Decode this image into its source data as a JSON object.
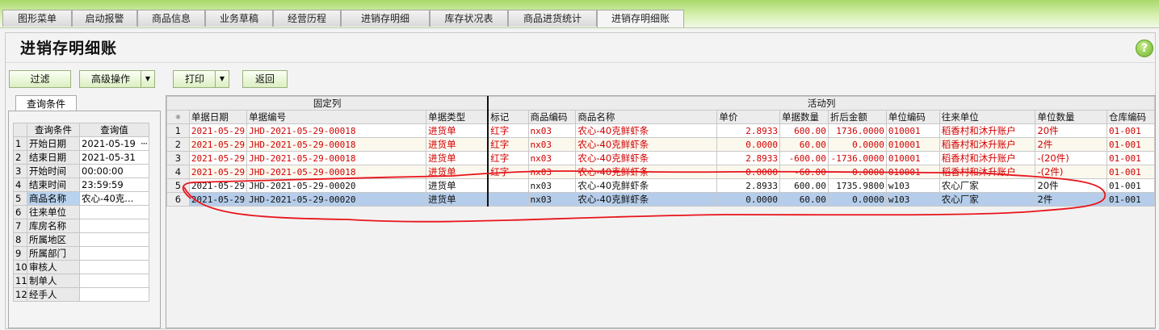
{
  "tabs": [
    {
      "label": "图形菜单",
      "active": false
    },
    {
      "label": "启动报警",
      "active": false
    },
    {
      "label": "商品信息",
      "active": false
    },
    {
      "label": "业务草稿",
      "active": false
    },
    {
      "label": "经营历程",
      "active": false
    },
    {
      "label": "进销存明细",
      "active": false
    },
    {
      "label": "库存状况表",
      "active": false
    },
    {
      "label": "商品进货统计",
      "active": false
    },
    {
      "label": "进销存明细账",
      "active": true
    }
  ],
  "page": {
    "title": "进销存明细账",
    "help_icon": "help-icon",
    "help_glyph": "?"
  },
  "toolbar": {
    "filter": "过滤",
    "advanced": "高级操作",
    "print": "打印",
    "back": "返回"
  },
  "query": {
    "tab_label": "查询条件",
    "col_condition": "查询条件",
    "col_value": "查询值",
    "rows": [
      {
        "n": "1",
        "key": "开始日期",
        "value": "2021-05-19",
        "more": "···"
      },
      {
        "n": "2",
        "key": "结束日期",
        "value": "2021-05-31"
      },
      {
        "n": "3",
        "key": "开始时间",
        "value": "00:00:00"
      },
      {
        "n": "4",
        "key": "结束时间",
        "value": "23:59:59"
      },
      {
        "n": "5",
        "key": "商品名称",
        "value": "农心-40克..."
      },
      {
        "n": "6",
        "key": "往来单位",
        "value": ""
      },
      {
        "n": "7",
        "key": "库房名称",
        "value": ""
      },
      {
        "n": "8",
        "key": "所属地区",
        "value": ""
      },
      {
        "n": "9",
        "key": "所属部门",
        "value": ""
      },
      {
        "n": "10",
        "key": "审核人",
        "value": ""
      },
      {
        "n": "11",
        "key": "制单人",
        "value": ""
      },
      {
        "n": "12",
        "key": "经手人",
        "value": ""
      }
    ]
  },
  "grid": {
    "group_fixed": "固定列",
    "group_active": "活动列",
    "corner": "⁕",
    "columns": [
      "单据日期",
      "单据编号",
      "单据类型",
      "标记",
      "商品编码",
      "商品名称",
      "单价",
      "单据数量",
      "折后金额",
      "单位编码",
      "往来单位",
      "单位数量",
      "仓库编码"
    ],
    "rows": [
      {
        "n": "1",
        "date": "2021-05-29",
        "no": "JHD-2021-05-29-00018",
        "type": "进货单",
        "mark": "红字",
        "code": "nx03",
        "name": "农心-40克鲜虾条",
        "price": "2.8933",
        "qty": "600.00",
        "amount": "1736.0000",
        "unit_code": "010001",
        "partner": "稻香村和沐升账户",
        "unit_qty": "20件",
        "wh": "01-001",
        "style": "red"
      },
      {
        "n": "2",
        "date": "2021-05-29",
        "no": "JHD-2021-05-29-00018",
        "type": "进货单",
        "mark": "红字",
        "code": "nx03",
        "name": "农心-40克鲜虾条",
        "price": "0.0000",
        "qty": "60.00",
        "amount": "0.0000",
        "unit_code": "010001",
        "partner": "稻香村和沐升账户",
        "unit_qty": "2件",
        "wh": "01-001",
        "style": "red"
      },
      {
        "n": "3",
        "date": "2021-05-29",
        "no": "JHD-2021-05-29-00018",
        "type": "进货单",
        "mark": "红字",
        "code": "nx03",
        "name": "农心-40克鲜虾条",
        "price": "2.8933",
        "qty": "-600.00",
        "amount": "-1736.0000",
        "unit_code": "010001",
        "partner": "稻香村和沐升账户",
        "unit_qty": "-(20件)",
        "wh": "01-001",
        "style": "red"
      },
      {
        "n": "4",
        "date": "2021-05-29",
        "no": "JHD-2021-05-29-00018",
        "type": "进货单",
        "mark": "红字",
        "code": "nx03",
        "name": "农心-40克鲜虾条",
        "price": "0.0000",
        "qty": "-60.00",
        "amount": "0.0000",
        "unit_code": "010001",
        "partner": "稻香村和沐升账户",
        "unit_qty": "-(2件)",
        "wh": "01-001",
        "style": "red"
      },
      {
        "n": "5",
        "date": "2021-05-29",
        "no": "JHD-2021-05-29-00020",
        "type": "进货单",
        "mark": "",
        "code": "nx03",
        "name": "农心-40克鲜虾条",
        "price": "2.8933",
        "qty": "600.00",
        "amount": "1735.9800",
        "unit_code": "w103",
        "partner": "农心厂家",
        "unit_qty": "20件",
        "wh": "01-001",
        "style": "black"
      },
      {
        "n": "6",
        "date": "2021-05-29",
        "no": "JHD-2021-05-29-00020",
        "type": "进货单",
        "mark": "",
        "code": "nx03",
        "name": "农心-40克鲜虾条",
        "price": "0.0000",
        "qty": "60.00",
        "amount": "0.0000",
        "unit_code": "w103",
        "partner": "农心厂家",
        "unit_qty": "2件",
        "wh": "01-001",
        "style": "black sel"
      }
    ]
  },
  "colors": {
    "red_text": "#d20000",
    "selection": "#b5cdea",
    "annotation": "#e8141b"
  }
}
